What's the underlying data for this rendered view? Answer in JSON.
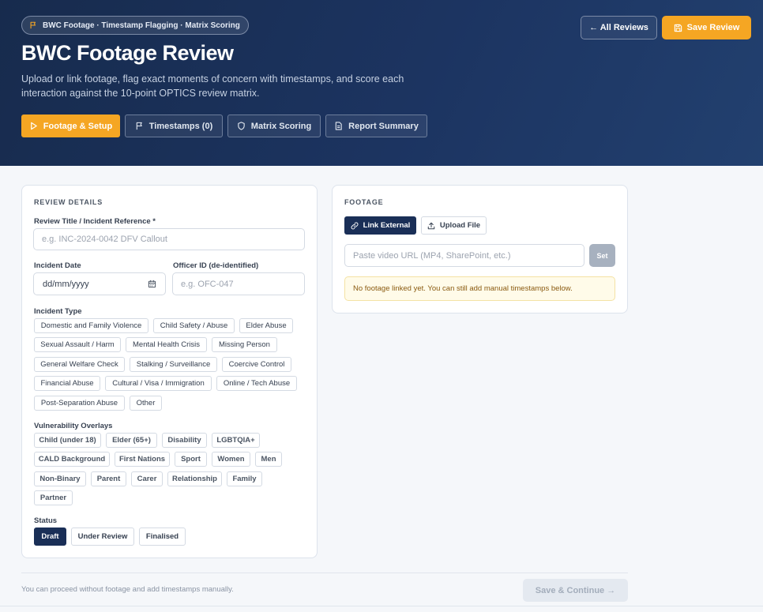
{
  "header": {
    "breadcrumb_pill": "BWC Footage · Timestamp Flagging · Matrix Scoring",
    "title": "BWC Footage Review",
    "description": "Upload or link footage, flag exact moments of concern with timestamps, and score each interaction against the 10-point OPTICS review matrix.",
    "all_reviews_label": "← All Reviews",
    "save_review_label": "Save Review"
  },
  "tabs": [
    {
      "label": "Footage & Setup",
      "icon": "play-icon",
      "active": true
    },
    {
      "label": "Timestamps (0)",
      "icon": "flag-icon",
      "active": false
    },
    {
      "label": "Matrix Scoring",
      "icon": "shield-icon",
      "active": false
    },
    {
      "label": "Report Summary",
      "icon": "document-icon",
      "active": false
    }
  ],
  "review_details": {
    "section_title": "REVIEW DETAILS",
    "title_label": "Review Title / Incident Reference *",
    "title_placeholder": "e.g. INC-2024-0042 DFV Callout",
    "date_label": "Incident Date",
    "date_placeholder": "dd/mm/yyyy",
    "officer_label": "Officer ID (de-identified)",
    "officer_placeholder": "e.g. OFC-047",
    "incident_type_label": "Incident Type",
    "incident_types": [
      "Domestic and Family Violence",
      "Child Safety / Abuse",
      "Elder Abuse",
      "Sexual Assault / Harm",
      "Mental Health Crisis",
      "Missing Person",
      "General Welfare Check",
      "Stalking / Surveillance",
      "Coercive Control",
      "Financial Abuse",
      "Cultural / Visa / Immigration",
      "Online / Tech Abuse",
      "Post-Separation Abuse",
      "Other"
    ],
    "vulnerability_label": "Vulnerability Overlays",
    "vulnerabilities": [
      "Child (under 18)",
      "Elder (65+)",
      "Disability",
      "LGBTQIA+",
      "CALD Background",
      "First Nations",
      "Sport",
      "Women",
      "Men",
      "Non-Binary",
      "Parent",
      "Carer",
      "Relationship",
      "Family",
      "Partner"
    ],
    "status_label": "Status",
    "statuses": [
      "Draft",
      "Under Review",
      "Finalised"
    ],
    "selected_status": "Draft"
  },
  "footage": {
    "section_title": "FOOTAGE",
    "link_external_label": "Link External",
    "upload_file_label": "Upload File",
    "url_placeholder": "Paste video URL (MP4, SharePoint, etc.)",
    "set_label": "Set",
    "notice": "No footage linked yet. You can still add manual timestamps below."
  },
  "footer": {
    "hint": "You can proceed without footage and add timestamps manually.",
    "continue_label": "Save & Continue →"
  },
  "colors": {
    "header_bg": "#1c3461",
    "accent": "#f5a623",
    "selected_chip": "#1a2f57"
  }
}
